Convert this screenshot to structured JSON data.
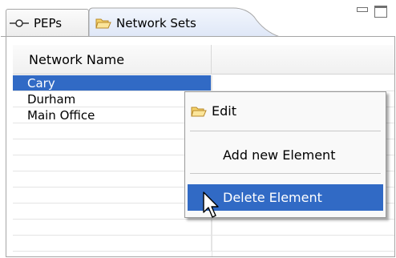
{
  "tabs": [
    {
      "label": "PEPs",
      "icon": "pep-connector-icon",
      "active": false
    },
    {
      "label": "Network Sets",
      "icon": "folder-icon",
      "active": true
    }
  ],
  "view_controls": {
    "minimize_icon": "minimize-icon",
    "maximize_icon": "maximize-icon"
  },
  "table": {
    "columns": [
      "Network Name",
      ""
    ],
    "rows": [
      {
        "name": "Cary",
        "selected": true
      },
      {
        "name": "Durham",
        "selected": false
      },
      {
        "name": "Main Office",
        "selected": false
      },
      {
        "name": "",
        "selected": false
      },
      {
        "name": "",
        "selected": false
      },
      {
        "name": "",
        "selected": false
      },
      {
        "name": "",
        "selected": false
      },
      {
        "name": "",
        "selected": false
      },
      {
        "name": "",
        "selected": false
      },
      {
        "name": "",
        "selected": false
      },
      {
        "name": "",
        "selected": false
      }
    ]
  },
  "context_menu": {
    "items": [
      {
        "label": "Edit",
        "icon": "folder-icon",
        "highlighted": false
      },
      {
        "label": "Add new Element",
        "highlighted": false
      },
      {
        "label": "Delete Element",
        "highlighted": true
      }
    ]
  },
  "colors": {
    "selection": "#316ac5",
    "folder_fill": "#f6d36b",
    "border": "#a6a6a6"
  },
  "cursor_icon": "arrow-cursor-icon"
}
